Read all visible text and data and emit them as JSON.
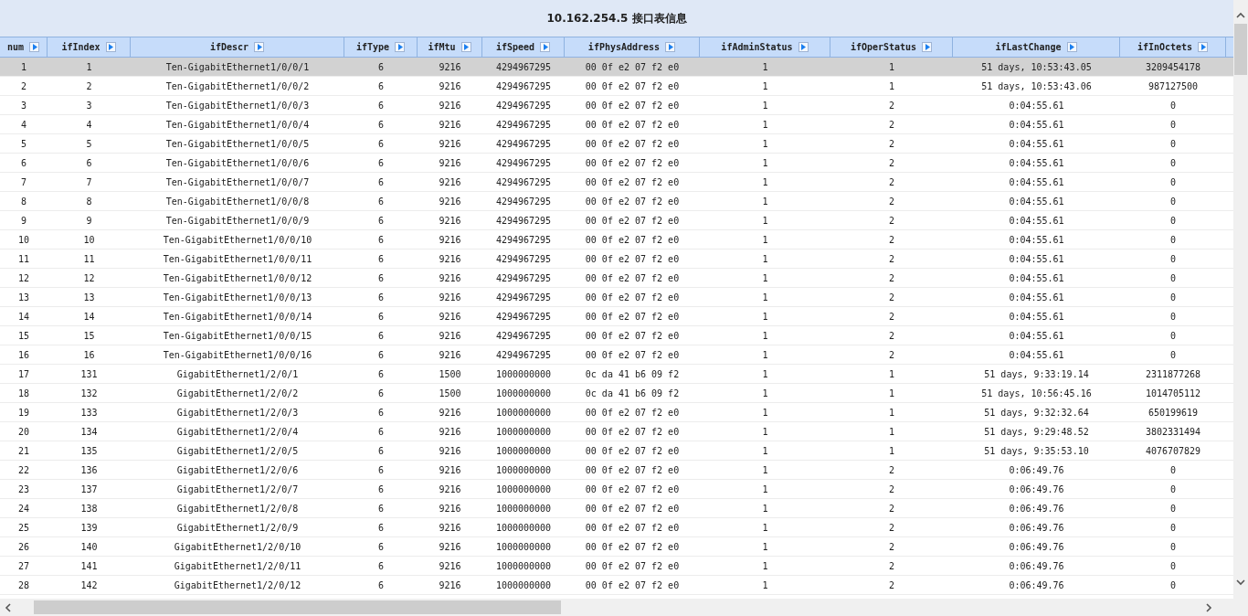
{
  "title": "10.162.254.5 接口表信息",
  "table": {
    "columns": [
      {
        "label": "num"
      },
      {
        "label": "ifIndex"
      },
      {
        "label": "ifDescr"
      },
      {
        "label": "ifType"
      },
      {
        "label": "ifMtu"
      },
      {
        "label": "ifSpeed"
      },
      {
        "label": "ifPhysAddress"
      },
      {
        "label": "ifAdminStatus"
      },
      {
        "label": "ifOperStatus"
      },
      {
        "label": "ifLastChange"
      },
      {
        "label": "ifInOctets"
      }
    ],
    "rows": [
      {
        "selected": true,
        "cells": [
          "1",
          "1",
          "Ten-GigabitEthernet1/0/0/1",
          "6",
          "9216",
          "4294967295",
          "00 0f e2 07 f2 e0",
          "1",
          "1",
          "51 days, 10:53:43.05",
          "3209454178"
        ]
      },
      {
        "selected": false,
        "cells": [
          "2",
          "2",
          "Ten-GigabitEthernet1/0/0/2",
          "6",
          "9216",
          "4294967295",
          "00 0f e2 07 f2 e0",
          "1",
          "1",
          "51 days, 10:53:43.06",
          "987127500"
        ]
      },
      {
        "selected": false,
        "cells": [
          "3",
          "3",
          "Ten-GigabitEthernet1/0/0/3",
          "6",
          "9216",
          "4294967295",
          "00 0f e2 07 f2 e0",
          "1",
          "2",
          "0:04:55.61",
          "0"
        ]
      },
      {
        "selected": false,
        "cells": [
          "4",
          "4",
          "Ten-GigabitEthernet1/0/0/4",
          "6",
          "9216",
          "4294967295",
          "00 0f e2 07 f2 e0",
          "1",
          "2",
          "0:04:55.61",
          "0"
        ]
      },
      {
        "selected": false,
        "cells": [
          "5",
          "5",
          "Ten-GigabitEthernet1/0/0/5",
          "6",
          "9216",
          "4294967295",
          "00 0f e2 07 f2 e0",
          "1",
          "2",
          "0:04:55.61",
          "0"
        ]
      },
      {
        "selected": false,
        "cells": [
          "6",
          "6",
          "Ten-GigabitEthernet1/0/0/6",
          "6",
          "9216",
          "4294967295",
          "00 0f e2 07 f2 e0",
          "1",
          "2",
          "0:04:55.61",
          "0"
        ]
      },
      {
        "selected": false,
        "cells": [
          "7",
          "7",
          "Ten-GigabitEthernet1/0/0/7",
          "6",
          "9216",
          "4294967295",
          "00 0f e2 07 f2 e0",
          "1",
          "2",
          "0:04:55.61",
          "0"
        ]
      },
      {
        "selected": false,
        "cells": [
          "8",
          "8",
          "Ten-GigabitEthernet1/0/0/8",
          "6",
          "9216",
          "4294967295",
          "00 0f e2 07 f2 e0",
          "1",
          "2",
          "0:04:55.61",
          "0"
        ]
      },
      {
        "selected": false,
        "cells": [
          "9",
          "9",
          "Ten-GigabitEthernet1/0/0/9",
          "6",
          "9216",
          "4294967295",
          "00 0f e2 07 f2 e0",
          "1",
          "2",
          "0:04:55.61",
          "0"
        ]
      },
      {
        "selected": false,
        "cells": [
          "10",
          "10",
          "Ten-GigabitEthernet1/0/0/10",
          "6",
          "9216",
          "4294967295",
          "00 0f e2 07 f2 e0",
          "1",
          "2",
          "0:04:55.61",
          "0"
        ]
      },
      {
        "selected": false,
        "cells": [
          "11",
          "11",
          "Ten-GigabitEthernet1/0/0/11",
          "6",
          "9216",
          "4294967295",
          "00 0f e2 07 f2 e0",
          "1",
          "2",
          "0:04:55.61",
          "0"
        ]
      },
      {
        "selected": false,
        "cells": [
          "12",
          "12",
          "Ten-GigabitEthernet1/0/0/12",
          "6",
          "9216",
          "4294967295",
          "00 0f e2 07 f2 e0",
          "1",
          "2",
          "0:04:55.61",
          "0"
        ]
      },
      {
        "selected": false,
        "cells": [
          "13",
          "13",
          "Ten-GigabitEthernet1/0/0/13",
          "6",
          "9216",
          "4294967295",
          "00 0f e2 07 f2 e0",
          "1",
          "2",
          "0:04:55.61",
          "0"
        ]
      },
      {
        "selected": false,
        "cells": [
          "14",
          "14",
          "Ten-GigabitEthernet1/0/0/14",
          "6",
          "9216",
          "4294967295",
          "00 0f e2 07 f2 e0",
          "1",
          "2",
          "0:04:55.61",
          "0"
        ]
      },
      {
        "selected": false,
        "cells": [
          "15",
          "15",
          "Ten-GigabitEthernet1/0/0/15",
          "6",
          "9216",
          "4294967295",
          "00 0f e2 07 f2 e0",
          "1",
          "2",
          "0:04:55.61",
          "0"
        ]
      },
      {
        "selected": false,
        "cells": [
          "16",
          "16",
          "Ten-GigabitEthernet1/0/0/16",
          "6",
          "9216",
          "4294967295",
          "00 0f e2 07 f2 e0",
          "1",
          "2",
          "0:04:55.61",
          "0"
        ]
      },
      {
        "selected": false,
        "cells": [
          "17",
          "131",
          "GigabitEthernet1/2/0/1",
          "6",
          "1500",
          "1000000000",
          "0c da 41 b6 09 f2",
          "1",
          "1",
          "51 days, 9:33:19.14",
          "2311877268"
        ]
      },
      {
        "selected": false,
        "cells": [
          "18",
          "132",
          "GigabitEthernet1/2/0/2",
          "6",
          "1500",
          "1000000000",
          "0c da 41 b6 09 f2",
          "1",
          "1",
          "51 days, 10:56:45.16",
          "1014705112"
        ]
      },
      {
        "selected": false,
        "cells": [
          "19",
          "133",
          "GigabitEthernet1/2/0/3",
          "6",
          "9216",
          "1000000000",
          "00 0f e2 07 f2 e0",
          "1",
          "1",
          "51 days, 9:32:32.64",
          "650199619"
        ]
      },
      {
        "selected": false,
        "cells": [
          "20",
          "134",
          "GigabitEthernet1/2/0/4",
          "6",
          "9216",
          "1000000000",
          "00 0f e2 07 f2 e0",
          "1",
          "1",
          "51 days, 9:29:48.52",
          "3802331494"
        ]
      },
      {
        "selected": false,
        "cells": [
          "21",
          "135",
          "GigabitEthernet1/2/0/5",
          "6",
          "9216",
          "1000000000",
          "00 0f e2 07 f2 e0",
          "1",
          "1",
          "51 days, 9:35:53.10",
          "4076707829"
        ]
      },
      {
        "selected": false,
        "cells": [
          "22",
          "136",
          "GigabitEthernet1/2/0/6",
          "6",
          "9216",
          "1000000000",
          "00 0f e2 07 f2 e0",
          "1",
          "2",
          "0:06:49.76",
          "0"
        ]
      },
      {
        "selected": false,
        "cells": [
          "23",
          "137",
          "GigabitEthernet1/2/0/7",
          "6",
          "9216",
          "1000000000",
          "00 0f e2 07 f2 e0",
          "1",
          "2",
          "0:06:49.76",
          "0"
        ]
      },
      {
        "selected": false,
        "cells": [
          "24",
          "138",
          "GigabitEthernet1/2/0/8",
          "6",
          "9216",
          "1000000000",
          "00 0f e2 07 f2 e0",
          "1",
          "2",
          "0:06:49.76",
          "0"
        ]
      },
      {
        "selected": false,
        "cells": [
          "25",
          "139",
          "GigabitEthernet1/2/0/9",
          "6",
          "9216",
          "1000000000",
          "00 0f e2 07 f2 e0",
          "1",
          "2",
          "0:06:49.76",
          "0"
        ]
      },
      {
        "selected": false,
        "cells": [
          "26",
          "140",
          "GigabitEthernet1/2/0/10",
          "6",
          "9216",
          "1000000000",
          "00 0f e2 07 f2 e0",
          "1",
          "2",
          "0:06:49.76",
          "0"
        ]
      },
      {
        "selected": false,
        "cells": [
          "27",
          "141",
          "GigabitEthernet1/2/0/11",
          "6",
          "9216",
          "1000000000",
          "00 0f e2 07 f2 e0",
          "1",
          "2",
          "0:06:49.76",
          "0"
        ]
      },
      {
        "selected": false,
        "cells": [
          "28",
          "142",
          "GigabitEthernet1/2/0/12",
          "6",
          "9216",
          "1000000000",
          "00 0f e2 07 f2 e0",
          "1",
          "2",
          "0:06:49.76",
          "0"
        ]
      }
    ]
  }
}
